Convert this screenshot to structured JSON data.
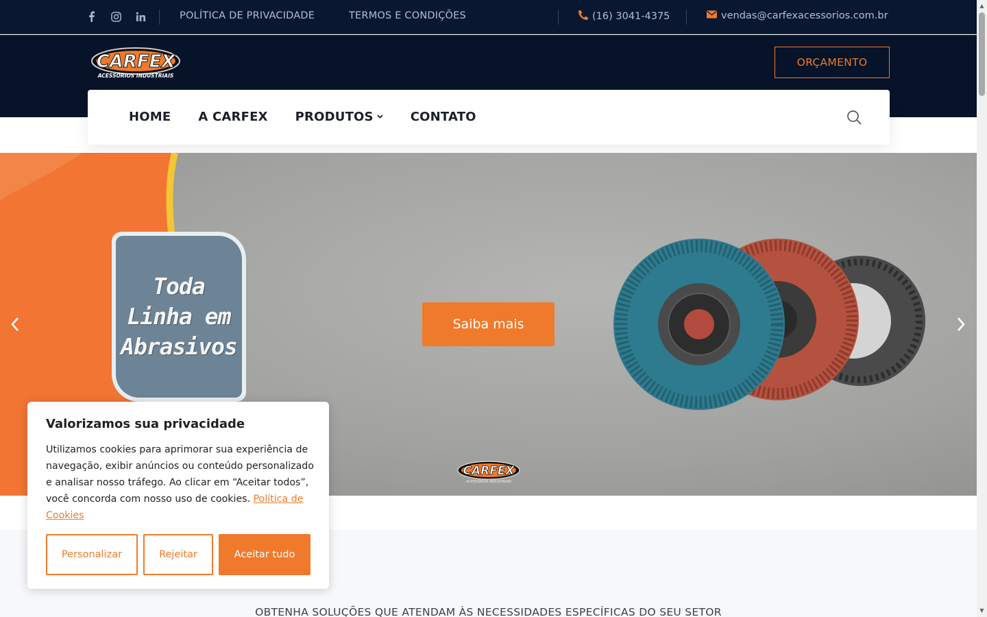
{
  "topbar": {
    "social_icons": [
      "facebook-icon",
      "instagram-icon",
      "linkedin-icon"
    ],
    "links": [
      "POLÍTICA DE PRIVACIDADE",
      "TERMOS E CONDIÇÕES"
    ],
    "phone": "(16) 3041-4375",
    "email": "vendas@carfexacessorios.com.br"
  },
  "header": {
    "logo_text": "CARFEX",
    "logo_tagline": "ACESSÓRIOS INDUSTRIAIS",
    "quote_label": "ORÇAMENTO"
  },
  "nav": {
    "items": [
      "HOME",
      "A CARFEX",
      "PRODUTOS",
      "CONTATO"
    ]
  },
  "hero": {
    "card_lines": [
      "Toda",
      "Linha em",
      "Abrasivos"
    ],
    "cta_label": "Saiba mais",
    "logo_text": "CARFEX",
    "logo_tagline": "ACESSÓRIOS INDUSTRIAIS"
  },
  "band": {
    "text": "OBTENHA SOLUÇÕES QUE ATENDAM ÀS NECESSIDADES ESPECÍFICAS DO SEU SETOR"
  },
  "cookie": {
    "title": "Valorizamos sua privacidade",
    "body": "Utilizamos cookies para aprimorar sua experiência de navegação, exibir anúncios ou conteúdo personalizado e analisar nosso tráfego. Ao clicar em “Aceitar todos”, você concorda com nosso uso de cookies.",
    "link": "Política de Cookies",
    "buttons": {
      "customize": "Personalizar",
      "reject": "Rejeitar",
      "accept": "Aceitar tudo"
    }
  },
  "colors": {
    "accent": "#f07a2b",
    "topbar_bg": "#0a1730",
    "header_bg": "#061329"
  }
}
